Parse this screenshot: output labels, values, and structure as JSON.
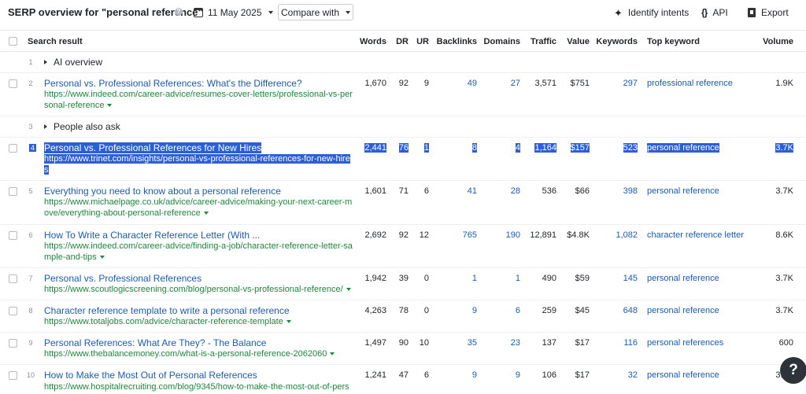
{
  "header": {
    "title": "SERP overview for \"personal reference\"",
    "date": "11 May 2025",
    "compare_label": "Compare with",
    "identify_label": "Identify intents",
    "api_label": "API",
    "export_label": "Export"
  },
  "columns": {
    "result": "Search result",
    "words": "Words",
    "dr": "DR",
    "ur": "UR",
    "backlinks": "Backlinks",
    "domains": "Domains",
    "traffic": "Traffic",
    "value": "Value",
    "keywords": "Keywords",
    "top_keyword": "Top keyword",
    "volume": "Volume"
  },
  "groups": {
    "ai": {
      "num": "1",
      "label": "AI overview"
    },
    "paa": {
      "num": "3",
      "label": "People also ask"
    }
  },
  "rows": [
    {
      "num": "2",
      "title": "Personal vs. Professional References: What's the Difference?",
      "url": "https://www.indeed.com/career-advice/resumes-cover-letters/professional-vs-personal-reference",
      "words": "1,670",
      "dr": "92",
      "ur": "9",
      "backlinks": "49",
      "domains": "27",
      "traffic": "3,571",
      "value": "$751",
      "keywords": "297",
      "top_keyword": "professional reference",
      "volume": "1.9K"
    },
    {
      "num": "4",
      "title": "Personal vs. Professional References for New Hires",
      "url": "https://www.trinet.com/insights/personal-vs-professional-references-for-new-hires",
      "words": "2,441",
      "dr": "76",
      "ur": "1",
      "backlinks": "8",
      "domains": "4",
      "traffic": "1,164",
      "value": "$157",
      "keywords": "523",
      "top_keyword": "personal reference",
      "volume": "3.7K"
    },
    {
      "num": "5",
      "title": "Everything you need to know about a personal reference",
      "url": "https://www.michaelpage.co.uk/advice/career-advice/making-your-next-career-move/everything-about-personal-reference",
      "words": "1,601",
      "dr": "71",
      "ur": "6",
      "backlinks": "41",
      "domains": "28",
      "traffic": "536",
      "value": "$66",
      "keywords": "398",
      "top_keyword": "personal reference",
      "volume": "3.7K"
    },
    {
      "num": "6",
      "title": "How To Write a Character Reference Letter (With ...",
      "url": "https://www.indeed.com/career-advice/finding-a-job/character-reference-letter-sample-and-tips",
      "words": "2,692",
      "dr": "92",
      "ur": "12",
      "backlinks": "765",
      "domains": "190",
      "traffic": "12,891",
      "value": "$4.8K",
      "keywords": "1,082",
      "top_keyword": "character reference letter",
      "volume": "8.6K"
    },
    {
      "num": "7",
      "title": "Personal vs. Professional References",
      "url": "https://www.scoutlogicscreening.com/blog/personal-vs-professional-reference/",
      "words": "1,942",
      "dr": "39",
      "ur": "0",
      "backlinks": "1",
      "domains": "1",
      "traffic": "490",
      "value": "$59",
      "keywords": "145",
      "top_keyword": "personal reference",
      "volume": "3.7K"
    },
    {
      "num": "8",
      "title": "Character reference template to write a personal reference",
      "url": "https://www.totaljobs.com/advice/character-reference-template",
      "words": "4,263",
      "dr": "78",
      "ur": "0",
      "backlinks": "9",
      "domains": "6",
      "traffic": "259",
      "value": "$45",
      "keywords": "648",
      "top_keyword": "personal reference",
      "volume": "3.7K"
    },
    {
      "num": "9",
      "title": "Personal References: What Are They? - The Balance",
      "url": "https://www.thebalancemoney.com/what-is-a-personal-reference-2062060",
      "words": "1,497",
      "dr": "90",
      "ur": "10",
      "backlinks": "35",
      "domains": "23",
      "traffic": "137",
      "value": "$17",
      "keywords": "116",
      "top_keyword": "personal references",
      "volume": "600"
    },
    {
      "num": "10",
      "title": "How to Make the Most Out of Personal References",
      "url": "https://www.hospitalrecruiting.com/blog/9345/how-to-make-the-most-out-of-pers",
      "words": "1,241",
      "dr": "47",
      "ur": "6",
      "backlinks": "9",
      "domains": "9",
      "traffic": "106",
      "value": "$17",
      "keywords": "32",
      "top_keyword": "personal reference",
      "volume": "3.7K"
    }
  ],
  "help": {
    "label": "?"
  }
}
